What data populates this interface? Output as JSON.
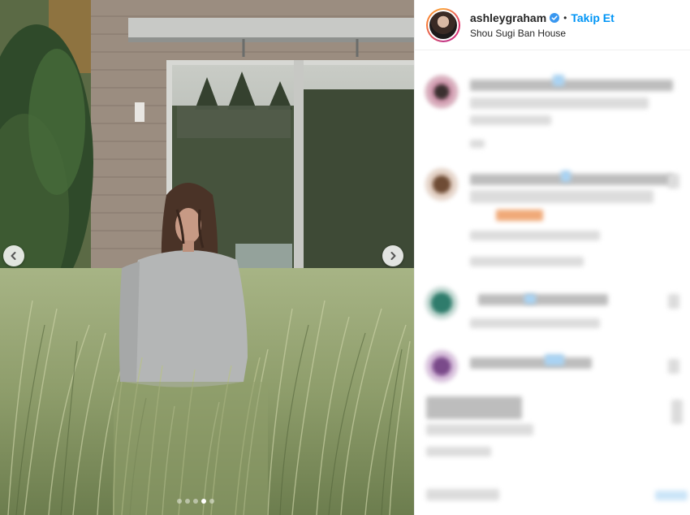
{
  "post": {
    "username": "ashleygraham",
    "separator": "•",
    "follow_label": "Takip Et",
    "location": "Shou Sugi Ban House",
    "carousel": {
      "slide_count": 5,
      "active_index": 3
    },
    "icons": {
      "verified": "verified-badge-icon",
      "prev": "chevron-left-icon",
      "next": "chevron-right-icon"
    },
    "colors": {
      "link": "#0095f6",
      "verified": "#3897f0"
    }
  }
}
